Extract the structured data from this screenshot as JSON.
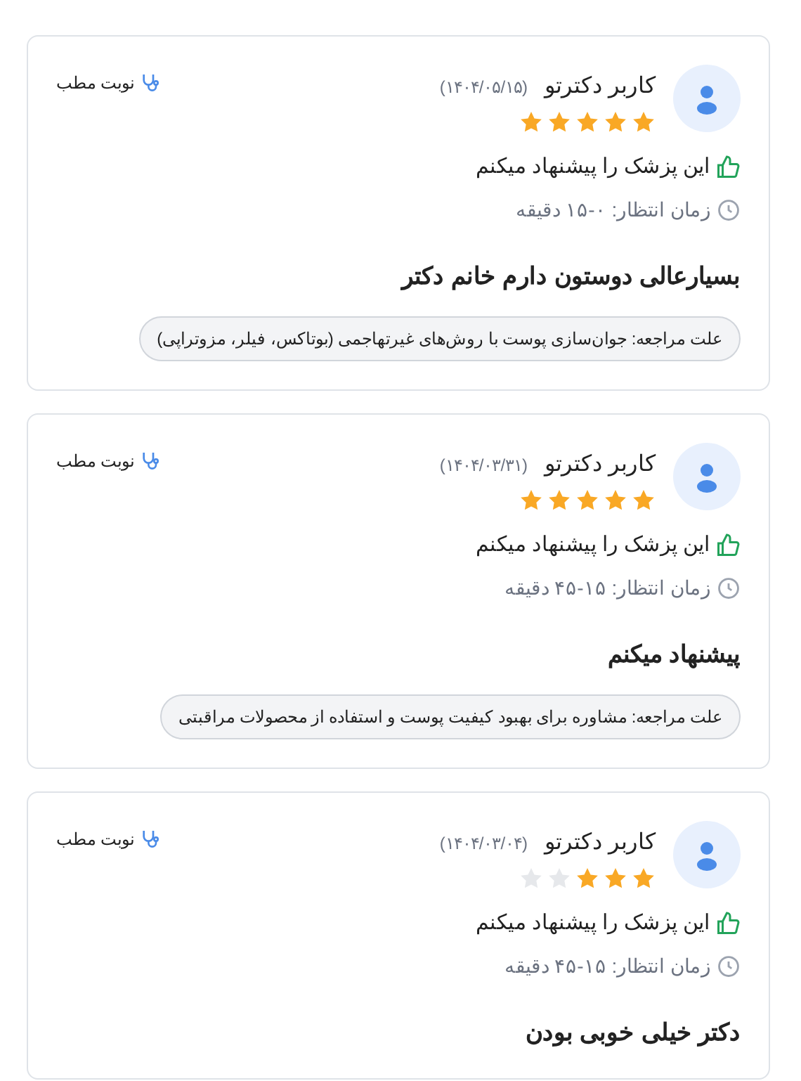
{
  "reviews": [
    {
      "user": "کاربر دکترتو",
      "date": "(۱۴۰۴/۰۵/۱۵)",
      "stars": 5,
      "appointment": "نوبت مطب",
      "recommend": "این پزشک را پیشنهاد میکنم",
      "wait": "زمان انتظار: ۰-۱۵ دقیقه",
      "comment": "بسیارعالی دوستون دارم خانم دکتر",
      "reason": "علت مراجعه: جوان‌سازی پوست با روش‌های غیرتهاجمی (بوتاکس، فیلر، مزوتراپی)"
    },
    {
      "user": "کاربر دکترتو",
      "date": "(۱۴۰۴/۰۳/۳۱)",
      "stars": 5,
      "appointment": "نوبت مطب",
      "recommend": "این پزشک را پیشنهاد میکنم",
      "wait": "زمان انتظار: ۱۵-۴۵ دقیقه",
      "comment": "پیشنهاد میکنم",
      "reason": "علت مراجعه: مشاوره برای بهبود کیفیت پوست و استفاده از محصولات مراقبتی"
    },
    {
      "user": "کاربر دکترتو",
      "date": "(۱۴۰۴/۰۳/۰۴)",
      "stars": 3,
      "appointment": "نوبت مطب",
      "recommend": "این پزشک را پیشنهاد میکنم",
      "wait": "زمان انتظار: ۱۵-۴۵ دقیقه",
      "comment": "دکتر خیلی خوبی بودن"
    }
  ]
}
